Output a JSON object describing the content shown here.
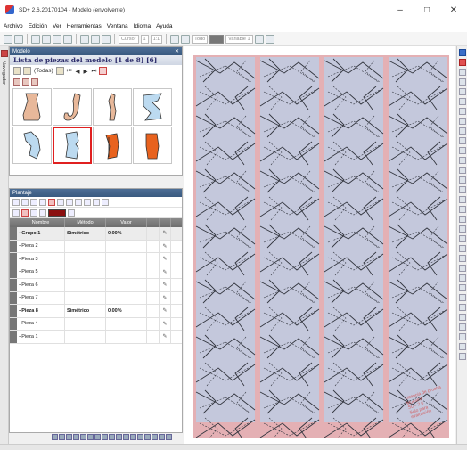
{
  "window": {
    "title": "SD+ 2.6.20170104 - Modelo (envolvente)",
    "minimize": "–",
    "maximize": "□",
    "close": "✕"
  },
  "menu": [
    "Archivo",
    "Edición",
    "Ver",
    "Herramientas",
    "Ventana",
    "Idioma",
    "Ayuda"
  ],
  "toolbar": {
    "combo1": "Cursor",
    "combo2": "1",
    "combo3": "1:1",
    "combo4": "Todo",
    "combo5": "Variable 1"
  },
  "left_strip": {
    "label": "Navegador"
  },
  "model_panel": {
    "header": "Modelo",
    "title": "Lista de piezas del modelo [1 de 8] [6]",
    "filter": "(Todas)",
    "nav": [
      "⏮",
      "◀",
      "▶",
      "⏭"
    ]
  },
  "plantaje_panel": {
    "header": "Plantaje",
    "columns": [
      "Nombre",
      "Método",
      "Valor"
    ],
    "rows": [
      {
        "name": "Grupo 1",
        "method": "Simétrico",
        "value": "0.00%",
        "group": true
      },
      {
        "name": "Pieza 2",
        "method": "",
        "value": "",
        "group": false
      },
      {
        "name": "Pieza 3",
        "method": "",
        "value": "",
        "group": false
      },
      {
        "name": "Pieza 5",
        "method": "",
        "value": "",
        "group": false
      },
      {
        "name": "Pieza 6",
        "method": "",
        "value": "",
        "group": false
      },
      {
        "name": "Pieza 7",
        "method": "",
        "value": "",
        "group": false
      },
      {
        "name": "Pieza 8",
        "method": "Simétrico",
        "value": "0.00%",
        "group": false,
        "bold": true
      },
      {
        "name": "Pieza 4",
        "method": "",
        "value": "",
        "group": false
      },
      {
        "name": "Pieza 1",
        "method": "",
        "value": "",
        "group": false
      }
    ]
  },
  "colors": {
    "canvas_bg": "#e4b0b4",
    "piece_fill": "#c4c8dc",
    "piece_stroke": "#33363f",
    "selection": "#e02020",
    "plantaje_color": "#8b1010"
  },
  "stamp_text": [
    "Licencia de prueba",
    "Muestra",
    "SD+ 2.6",
    "Solo para",
    "evaluación"
  ]
}
